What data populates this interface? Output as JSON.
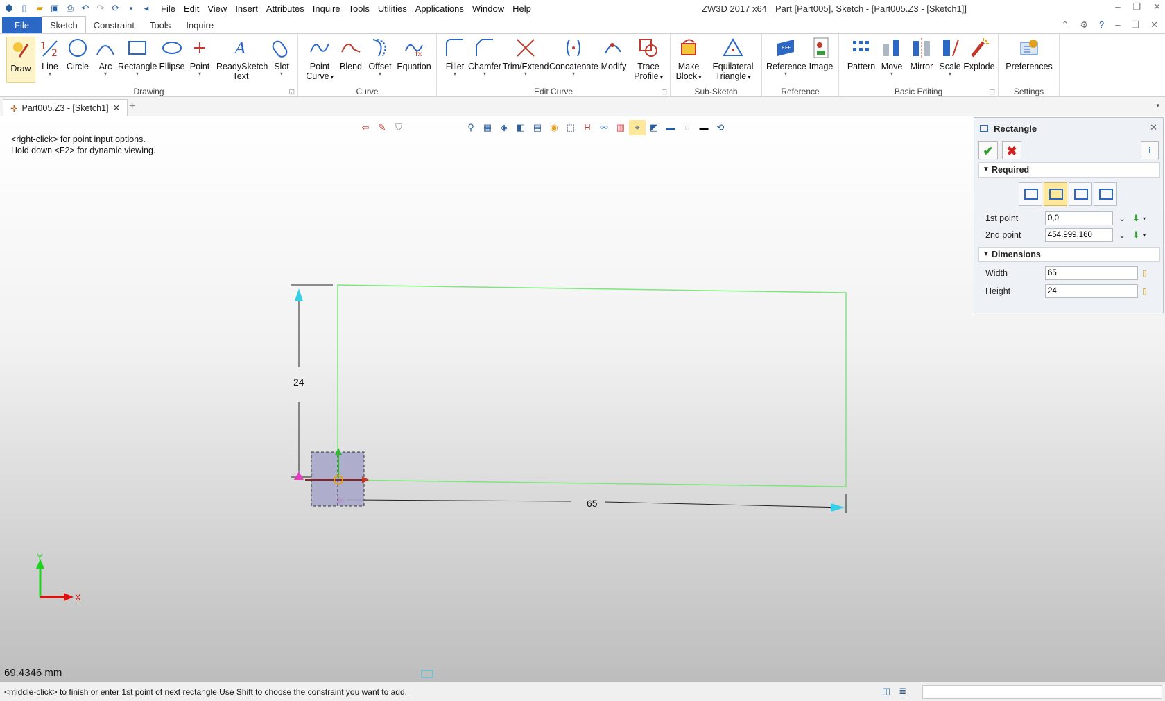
{
  "window": {
    "app_title": "ZW3D 2017  x64",
    "doc_title": "Part [Part005],  Sketch - [Part005.Z3 - [Sketch1]]"
  },
  "menubar": [
    "File",
    "Edit",
    "View",
    "Insert",
    "Attributes",
    "Inquire",
    "Tools",
    "Utilities",
    "Applications",
    "Window",
    "Help"
  ],
  "ribbon_tabs": {
    "file": "File",
    "tabs": [
      "Sketch",
      "Constraint",
      "Tools",
      "Inquire"
    ],
    "active": "Sketch"
  },
  "ribbon": {
    "drawing": {
      "label": "Drawing",
      "buttons": [
        "Draw",
        "Line",
        "Circle",
        "Arc",
        "Rectangle",
        "Ellipse",
        "Point",
        "ReadySketch",
        "Text",
        "Slot"
      ]
    },
    "curve": {
      "label": "Curve",
      "point": "Point",
      "point2": "Curve",
      "blend": "Blend",
      "offset": "Offset",
      "equation": "Equation"
    },
    "edit_curve": {
      "label": "Edit Curve",
      "fillet": "Fillet",
      "chamfer": "Chamfer",
      "trim": "Trim/Extend",
      "concat": "Concatenate",
      "modify": "Modify",
      "trace": "Trace",
      "trace2": "Profile"
    },
    "sub_sketch": {
      "label": "Sub-Sketch",
      "make": "Make",
      "make2": "Block",
      "eq": "Equilateral",
      "eq2": "Triangle"
    },
    "reference": {
      "label": "Reference",
      "ref": "Reference",
      "image": "Image"
    },
    "basic_editing": {
      "label": "Basic Editing",
      "pattern": "Pattern",
      "move": "Move",
      "mirror": "Mirror",
      "scale": "Scale",
      "explode": "Explode"
    },
    "settings": {
      "label": "Settings",
      "prefs": "Preferences"
    }
  },
  "doc_tab": "Part005.Z3 - [Sketch1]",
  "viewport": {
    "hint1": "<right-click> for point input options.",
    "hint2": "Hold down <F2> for dynamic viewing.",
    "dim_height": "24",
    "dim_width": "65",
    "axis_x": "X",
    "axis_y": "Y",
    "measure": "69.4346 mm"
  },
  "panel": {
    "title": "Rectangle",
    "required": "Required",
    "first_point_label": "1st point",
    "first_point_value": "0,0",
    "second_point_label": "2nd point",
    "second_point_value": "454.999,160",
    "dimensions": "Dimensions",
    "width_label": "Width",
    "width_value": "65",
    "height_label": "Height",
    "height_value": "24"
  },
  "status": {
    "text": "<middle-click> to finish or enter 1st point of next rectangle.Use Shift to choose the constraint you want to add."
  },
  "colors": {
    "accent": "#2b68c6",
    "sketch_line": "#7be87b",
    "highlight": "#fde89b"
  }
}
